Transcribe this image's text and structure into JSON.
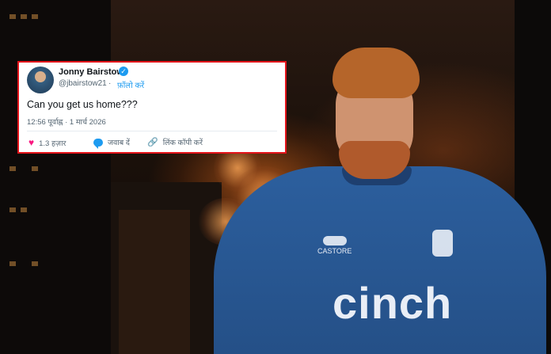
{
  "tweet": {
    "name": "Jonny Bairstow",
    "handle": "@jbairstow21",
    "follow_separator": "·",
    "follow_label": "फ़ॉलो करें",
    "text": "Can you get us home???",
    "timestamp": "12:56 पूर्वाह्न · 1 मार्च 2026",
    "likes": "1.3 हज़ार",
    "reply_label": "जवाब दें",
    "copy_link_label": "लिंक कॉपी करें"
  },
  "shirt": {
    "brand": "CASTORE",
    "sponsor": "cinch"
  },
  "colors": {
    "highlight_border": "#e4141a",
    "accent_blue": "#1d9bf0",
    "heart_pink": "#f91880",
    "shirt_blue": "#2c5f9e"
  },
  "icons": [
    "verified-badge-icon",
    "heart-icon",
    "reply-icon",
    "link-icon"
  ]
}
